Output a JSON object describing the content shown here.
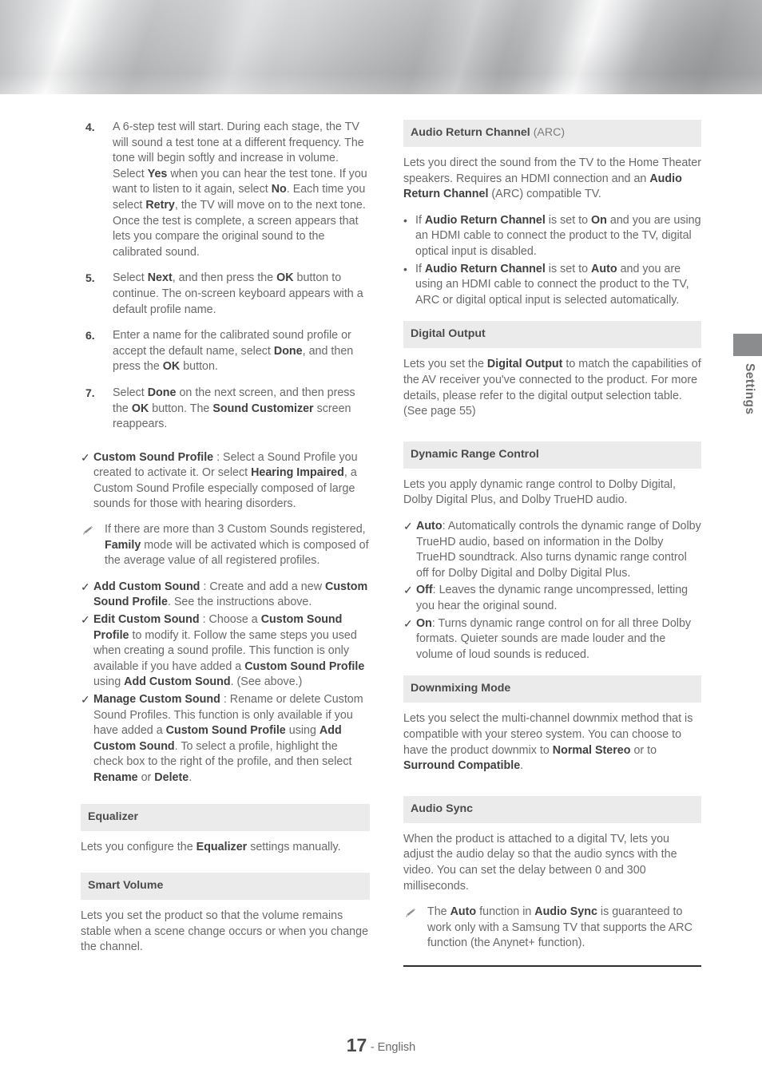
{
  "page": {
    "number": "17",
    "lang_label": "- English"
  },
  "side_tab": {
    "label": "Settings"
  },
  "icons": {
    "check": "✓",
    "bullet": "•",
    "note": "pencil-icon"
  },
  "left_column": {
    "steps": [
      {
        "num": "4.",
        "parts": [
          {
            "t": "A 6-step test will start. During each stage, the TV will sound a test tone at a different frequency. The tone will begin softly and increase in volume. Select ",
            "b": false
          },
          {
            "t": "Yes",
            "b": true
          },
          {
            "t": " when you can hear the test tone. If you want to listen to it again, select ",
            "b": false
          },
          {
            "t": "No",
            "b": true
          },
          {
            "t": ". Each time you select ",
            "b": false
          },
          {
            "t": "Retry",
            "b": true
          },
          {
            "t": ", the TV will move on to the next tone. Once the test is complete, a screen appears that lets you compare the original sound to the calibrated sound.",
            "b": false
          }
        ]
      },
      {
        "num": "5.",
        "parts": [
          {
            "t": "Select ",
            "b": false
          },
          {
            "t": "Next",
            "b": true
          },
          {
            "t": ", and then press the ",
            "b": false
          },
          {
            "t": "OK",
            "b": true
          },
          {
            "t": " button to continue. The on-screen keyboard appears with a default profile name.",
            "b": false
          }
        ]
      },
      {
        "num": "6.",
        "parts": [
          {
            "t": "Enter a name for the calibrated sound profile or accept the default name, select ",
            "b": false
          },
          {
            "t": "Done",
            "b": true
          },
          {
            "t": ", and then press the ",
            "b": false
          },
          {
            "t": "OK",
            "b": true
          },
          {
            "t": " button.",
            "b": false
          }
        ]
      },
      {
        "num": "7.",
        "parts": [
          {
            "t": "Select ",
            "b": false
          },
          {
            "t": "Done",
            "b": true
          },
          {
            "t": " on the next screen, and then press the ",
            "b": false
          },
          {
            "t": "OK",
            "b": true
          },
          {
            "t": " button. The ",
            "b": false
          },
          {
            "t": "Sound Customizer",
            "b": true
          },
          {
            "t": " screen reappears.",
            "b": false
          }
        ]
      }
    ],
    "check_items_1": [
      {
        "parts": [
          {
            "t": "Custom Sound Profile",
            "b": true
          },
          {
            "t": " : Select a Sound Profile you created to activate it. Or select ",
            "b": false
          },
          {
            "t": "Hearing Impaired",
            "b": true
          },
          {
            "t": ", a Custom Sound Profile especially composed of large sounds for those with hearing disorders.",
            "b": false
          }
        ]
      }
    ],
    "note_1": {
      "parts": [
        {
          "t": "If there are more than 3 Custom Sounds registered, ",
          "b": false
        },
        {
          "t": "Family",
          "b": true
        },
        {
          "t": " mode will be activated which is composed of the average value of all registered profiles.",
          "b": false
        }
      ]
    },
    "check_items_2": [
      {
        "parts": [
          {
            "t": "Add Custom Sound",
            "b": true
          },
          {
            "t": " : Create and add a new ",
            "b": false
          },
          {
            "t": "Custom Sound Profile",
            "b": true
          },
          {
            "t": ". See the instructions above.",
            "b": false
          }
        ]
      },
      {
        "parts": [
          {
            "t": "Edit Custom Sound",
            "b": true
          },
          {
            "t": " : Choose a ",
            "b": false
          },
          {
            "t": "Custom Sound Profile",
            "b": true
          },
          {
            "t": " to modify it. Follow the same steps you used when creating a sound profile. This function is only available if you have added a ",
            "b": false
          },
          {
            "t": "Custom Sound Profile",
            "b": true
          },
          {
            "t": " using ",
            "b": false
          },
          {
            "t": "Add Custom Sound",
            "b": true
          },
          {
            "t": ". (See above.)",
            "b": false
          }
        ]
      },
      {
        "parts": [
          {
            "t": "Manage Custom Sound",
            "b": true
          },
          {
            "t": " : Rename or delete Custom Sound Profiles. This function is only available if you have added a ",
            "b": false
          },
          {
            "t": "Custom Sound Profile",
            "b": true
          },
          {
            "t": " using ",
            "b": false
          },
          {
            "t": "Add Custom Sound",
            "b": true
          },
          {
            "t": ". To select a profile, highlight the check box to the right of the profile, and then select ",
            "b": false
          },
          {
            "t": "Rename",
            "b": true
          },
          {
            "t": " or ",
            "b": false
          },
          {
            "t": "Delete",
            "b": true
          },
          {
            "t": ".",
            "b": false
          }
        ]
      }
    ],
    "sections": [
      {
        "title": "Equalizer",
        "title_suffix": "",
        "body": [
          {
            "t": "Lets you configure the ",
            "b": false
          },
          {
            "t": "Equalizer",
            "b": true
          },
          {
            "t": " settings manually.",
            "b": false
          }
        ]
      },
      {
        "title": "Smart Volume",
        "title_suffix": "",
        "body": [
          {
            "t": "Lets you set the product so that the volume remains stable when a scene change occurs or when you change the channel.",
            "b": false
          }
        ]
      }
    ]
  },
  "right_column": {
    "sections": [
      {
        "title": "Audio Return Channel",
        "title_suffix": " (ARC)",
        "body": [
          {
            "t": "Lets you direct the sound from the TV to the Home Theater speakers. Requires an HDMI connection and an ",
            "b": false
          },
          {
            "t": "Audio Return Channel",
            "b": true
          },
          {
            "t": " (ARC) compatible TV.",
            "b": false
          }
        ],
        "bullets": [
          {
            "parts": [
              {
                "t": "If ",
                "b": false
              },
              {
                "t": "Audio Return Channel",
                "b": true
              },
              {
                "t": " is set to ",
                "b": false
              },
              {
                "t": "On",
                "b": true
              },
              {
                "t": " and you are using an HDMI cable to connect the product to the TV, digital optical input is disabled.",
                "b": false
              }
            ]
          },
          {
            "parts": [
              {
                "t": "If ",
                "b": false
              },
              {
                "t": "Audio Return Channel",
                "b": true
              },
              {
                "t": " is set to ",
                "b": false
              },
              {
                "t": "Auto",
                "b": true
              },
              {
                "t": " and you are using an HDMI cable to connect the product to the TV, ARC or digital optical input is selected automatically.",
                "b": false
              }
            ]
          }
        ]
      },
      {
        "title": "Digital Output",
        "title_suffix": "",
        "body": [
          {
            "t": "Lets you set the ",
            "b": false
          },
          {
            "t": "Digital Output",
            "b": true
          },
          {
            "t": " to match the capabilities of the AV receiver you've connected to the product. For more details, please refer to the digital output selection table. (See page 55)",
            "b": false
          }
        ],
        "bullets": []
      },
      {
        "title": "Dynamic Range Control",
        "title_suffix": "",
        "body": [
          {
            "t": "Lets you apply dynamic range control to Dolby Digital, Dolby Digital Plus, and Dolby TrueHD audio.",
            "b": false
          }
        ],
        "checks": [
          {
            "parts": [
              {
                "t": "Auto",
                "b": true
              },
              {
                "t": ": Automatically controls the dynamic range of Dolby TrueHD audio, based on information in the Dolby TrueHD soundtrack. Also turns dynamic range control off for Dolby Digital and Dolby Digital Plus.",
                "b": false
              }
            ]
          },
          {
            "parts": [
              {
                "t": "Off",
                "b": true
              },
              {
                "t": ": Leaves the dynamic range uncompressed, letting you hear the original sound.",
                "b": false
              }
            ]
          },
          {
            "parts": [
              {
                "t": "On",
                "b": true
              },
              {
                "t": ": Turns dynamic range control on for all three Dolby formats. Quieter sounds are made louder and the volume of loud sounds is reduced.",
                "b": false
              }
            ]
          }
        ]
      },
      {
        "title": "Downmixing Mode",
        "title_suffix": "",
        "body": [
          {
            "t": "Lets you select the multi-channel downmix method that is compatible with your stereo system. You can choose to have the product downmix to ",
            "b": false
          },
          {
            "t": "Normal Stereo",
            "b": true
          },
          {
            "t": " or to ",
            "b": false
          },
          {
            "t": "Surround Compatible",
            "b": true
          },
          {
            "t": ".",
            "b": false
          }
        ],
        "bullets": []
      },
      {
        "title": "Audio Sync",
        "title_suffix": "",
        "body": [
          {
            "t": "When the product is attached to a digital TV, lets you adjust the audio delay so that the audio syncs with the video. You can set the delay between 0 and 300 milliseconds.",
            "b": false
          }
        ],
        "bullets": []
      }
    ],
    "note_1": {
      "parts": [
        {
          "t": "The ",
          "b": false
        },
        {
          "t": "Auto",
          "b": true
        },
        {
          "t": " function in ",
          "b": false
        },
        {
          "t": "Audio Sync",
          "b": true
        },
        {
          "t": " is guaranteed to work only with a Samsung TV that supports the ARC function (the Anynet+ function).",
          "b": false
        }
      ]
    }
  }
}
